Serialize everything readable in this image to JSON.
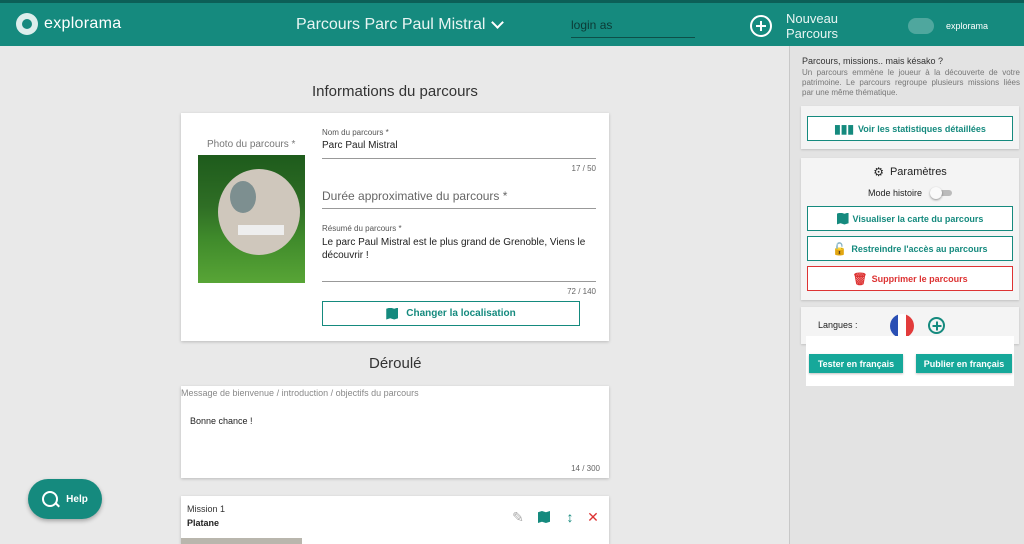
{
  "header": {
    "logo_text": "explorama",
    "course_select": "Parcours Parc Paul Mistral",
    "login_as_placeholder": "login as",
    "new_course_label": "Nouveau Parcours",
    "user_name": "explorama"
  },
  "info": {
    "title": "Informations du parcours",
    "photo_label": "Photo du parcours *",
    "name_label": "Nom du parcours *",
    "name_value": "Parc Paul Mistral",
    "name_counter": "17 / 50",
    "duration_placeholder": "Durée approximative du parcours *",
    "summary_label": "Résumé du parcours *",
    "summary_value": "Le parc Paul Mistral est le plus grand de Grenoble, Viens le découvrir !",
    "summary_counter": "72 / 140",
    "location_button": "Changer la localisation"
  },
  "deroule": {
    "title": "Déroulé",
    "welcome_placeholder": "Message de bienvenue / introduction / objectifs du parcours",
    "welcome_value": "Bonne chance !",
    "welcome_counter": "14 / 300"
  },
  "mission": {
    "number": "Mission 1",
    "name": "Platane"
  },
  "help": {
    "label": "Help"
  },
  "sidebar": {
    "kesako_title": "Parcours, missions.. mais késako ?",
    "kesako_text": "Un parcours emmène le joueur à la découverte de votre patrimoine. Le parcours regroupe plusieurs missions liées par une même thématique.",
    "stats_button": "Voir les statistiques détaillées",
    "params_title": "Paramètres",
    "story_mode_label": "Mode histoire",
    "story_mode_on": false,
    "map_button": "Visualiser la carte du parcours",
    "restrict_button": "Restreindre l'accès au parcours",
    "delete_button": "Supprimer le parcours",
    "languages_label": "Langues :",
    "test_button": "Tester en français",
    "publish_button": "Publier en français"
  },
  "colors": {
    "brand": "#158a7e",
    "danger": "#dd3333"
  }
}
